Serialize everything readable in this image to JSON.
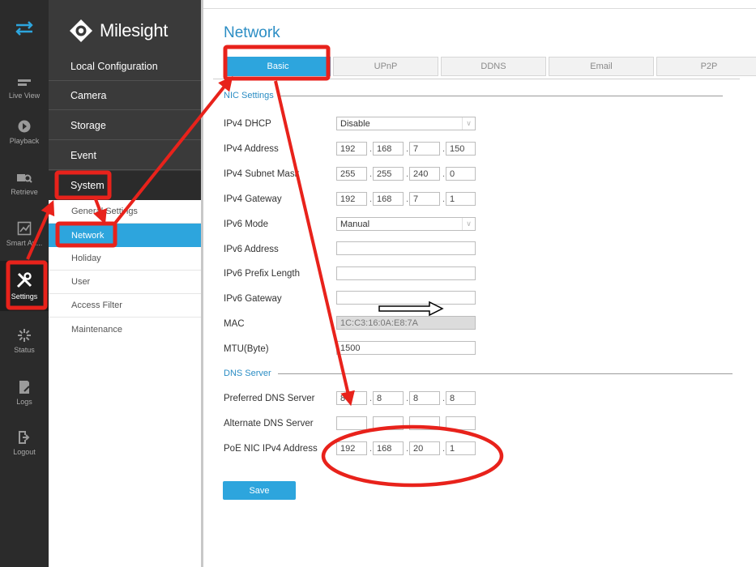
{
  "brand": {
    "logo_text": "Milesight"
  },
  "rail": {
    "items": [
      {
        "label": "Live View",
        "icon": "live-view-icon"
      },
      {
        "label": "Playback",
        "icon": "playback-icon"
      },
      {
        "label": "Retrieve",
        "icon": "retrieve-icon"
      },
      {
        "label": "Smart An...",
        "icon": "smart-analytics-icon"
      },
      {
        "label": "Settings",
        "icon": "settings-icon"
      },
      {
        "label": "Status",
        "icon": "status-icon"
      },
      {
        "label": "Logs",
        "icon": "logs-icon"
      },
      {
        "label": "Logout",
        "icon": "logout-icon"
      }
    ]
  },
  "menu": {
    "items": [
      "Local Configuration",
      "Camera",
      "Storage",
      "Event",
      "System"
    ],
    "sub_items": [
      "General Settings",
      "Network",
      "Holiday",
      "User",
      "Access Filter",
      "Maintenance"
    ]
  },
  "page": {
    "title": "Network",
    "tabs": [
      "Basic",
      "UPnP",
      "DDNS",
      "Email",
      "P2P"
    ]
  },
  "nic": {
    "section": "NIC Settings",
    "labels": {
      "dhcp": "IPv4 DHCP",
      "addr": "IPv4 Address",
      "mask": "IPv4 Subnet Mask",
      "gw": "IPv4 Gateway",
      "v6mode": "IPv6 Mode",
      "v6addr": "IPv6 Address",
      "v6prefix": "IPv6 Prefix Length",
      "v6gw": "IPv6 Gateway",
      "mac": "MAC",
      "mtu": "MTU(Byte)"
    },
    "dhcp_value": "Disable",
    "addr": [
      "192",
      "168",
      "7",
      "150"
    ],
    "mask": [
      "255",
      "255",
      "240",
      "0"
    ],
    "gw": [
      "192",
      "168",
      "7",
      "1"
    ],
    "v6mode_value": "Manual",
    "mac_value": "1C:C3:16:0A:E8:7A",
    "mtu_value": "1500"
  },
  "dns": {
    "section": "DNS Server",
    "labels": {
      "pref": "Preferred DNS Server",
      "alt": "Alternate DNS Server",
      "poe": "PoE NIC IPv4 Address"
    },
    "pref": [
      "8",
      "8",
      "8",
      "8"
    ],
    "alt": [
      "",
      "",
      "",
      ""
    ],
    "poe": [
      "192",
      "168",
      "20",
      "1"
    ]
  },
  "actions": {
    "save": "Save"
  },
  "colors": {
    "accent": "#2da5dd",
    "annotation": "#e8221b",
    "sidebar": "#2b2b2b"
  }
}
